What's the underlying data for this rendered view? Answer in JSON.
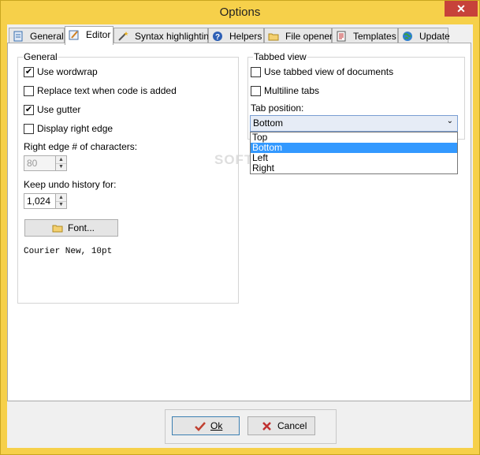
{
  "window": {
    "title": "Options",
    "close_glyph": "✕"
  },
  "tabs": [
    {
      "label": "General",
      "icon": "general-icon"
    },
    {
      "label": "Editor",
      "icon": "editor-icon",
      "active": true
    },
    {
      "label": "Syntax highlighting",
      "icon": "wand-icon"
    },
    {
      "label": "Helpers",
      "icon": "help-icon"
    },
    {
      "label": "File opener",
      "icon": "folder-icon"
    },
    {
      "label": "Templates",
      "icon": "document-icon"
    },
    {
      "label": "Update",
      "icon": "globe-icon"
    }
  ],
  "general": {
    "title": "General",
    "use_wordwrap": {
      "label": "Use wordwrap",
      "checked": true
    },
    "replace_text": {
      "label": "Replace text when code is added",
      "checked": false
    },
    "use_gutter": {
      "label": "Use gutter",
      "checked": true
    },
    "display_right_edge": {
      "label": "Display right edge",
      "checked": false
    },
    "right_edge_label": "Right edge # of characters:",
    "right_edge_value": "80",
    "undo_label": "Keep undo history for:",
    "undo_value": "1,024",
    "font_button": "Font...",
    "font_desc": "Courier New, 10pt"
  },
  "tabbed": {
    "title": "Tabbed view",
    "use_tabbed": {
      "label": "Use tabbed view of documents",
      "checked": false
    },
    "multiline": {
      "label": "Multiline tabs",
      "checked": false
    },
    "tab_position_label": "Tab position:",
    "tab_position_value": "Bottom",
    "options": [
      "Top",
      "Bottom",
      "Left",
      "Right"
    ],
    "selected_option": "Bottom"
  },
  "watermark": "SOFTPEDIA",
  "buttons": {
    "ok": "Ok",
    "cancel": "Cancel"
  },
  "colors": {
    "title_bar": "#f6d04a",
    "selection": "#3399ff",
    "close": "#c7423a"
  }
}
